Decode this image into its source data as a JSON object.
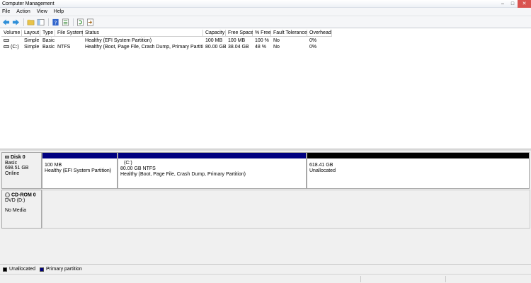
{
  "window": {
    "title": "Computer Management",
    "controls": {
      "minimize": "–",
      "maximize": "□",
      "close": "✕"
    }
  },
  "menu": [
    "File",
    "Action",
    "View",
    "Help"
  ],
  "toolbar": {
    "icons": [
      "back-icon",
      "forward-icon",
      "up-folder-icon",
      "show-hide-tree-icon",
      "help-icon",
      "properties-icon",
      "refresh-icon",
      "export-icon"
    ]
  },
  "volume_table": {
    "columns": [
      "Volume",
      "Layout",
      "Type",
      "File System",
      "Status",
      "Capacity",
      "Free Space",
      "% Free",
      "Fault Tolerance",
      "Overhead"
    ],
    "rows": [
      {
        "volume": "",
        "layout": "Simple",
        "type": "Basic",
        "fs": "",
        "status": "Healthy (EFI System Partition)",
        "capacity": "100 MB",
        "free": "100 MB",
        "pct": "100 %",
        "fault": "No",
        "overhead": "0%"
      },
      {
        "volume": "(C:)",
        "layout": "Simple",
        "type": "Basic",
        "fs": "NTFS",
        "status": "Healthy (Boot, Page File, Crash Dump, Primary Partition)",
        "capacity": "80.00 GB",
        "free": "38.04 GB",
        "pct": "48 %",
        "fault": "No",
        "overhead": "0%"
      }
    ]
  },
  "disks": [
    {
      "name": "Disk 0",
      "type": "Basic",
      "size": "698.51 GB",
      "state": "Online",
      "partitions": [
        {
          "label": "",
          "size": "100 MB",
          "desc": "Healthy (EFI System Partition)",
          "kind": "primary",
          "color": "#000080"
        },
        {
          "label": "(C:)",
          "size": "80.00 GB NTFS",
          "desc": "Healthy (Boot, Page File, Crash Dump, Primary Partition)",
          "kind": "primary",
          "color": "#000080"
        },
        {
          "label": "",
          "size": "618.41 GB",
          "desc": "Unallocated",
          "kind": "unallocated",
          "color": "#000000"
        }
      ]
    },
    {
      "name": "CD-ROM 0",
      "type": "DVD (D:)",
      "size": "",
      "state": "No Media"
    }
  ],
  "legend": [
    {
      "label": "Unallocated",
      "color": "#000000"
    },
    {
      "label": "Primary partition",
      "color": "#000080"
    }
  ]
}
